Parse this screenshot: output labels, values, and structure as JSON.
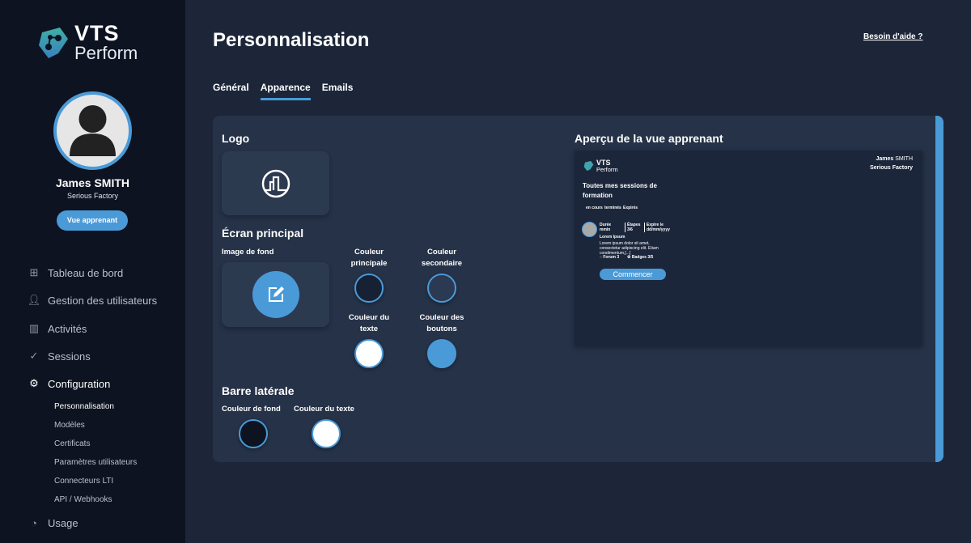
{
  "brand": {
    "line1": "VTS",
    "line2": "Perform"
  },
  "user": {
    "name": "James SMITH",
    "org": "Serious Factory",
    "learner_view_button": "Vue apprenant"
  },
  "nav": {
    "items": [
      {
        "label": "Tableau de bord",
        "icon": "dashboard-icon"
      },
      {
        "label": "Gestion des utilisateurs",
        "icon": "user-icon"
      },
      {
        "label": "Activités",
        "icon": "library-icon"
      },
      {
        "label": "Sessions",
        "icon": "route-icon"
      },
      {
        "label": "Configuration",
        "icon": "gear-icon"
      },
      {
        "label": "Usage",
        "icon": "gauge-icon"
      }
    ],
    "sub_items": [
      "Personnalisation",
      "Modèles",
      "Certificats",
      "Paramètres utilisateurs",
      "Connecteurs LTI",
      "API / Webhooks"
    ]
  },
  "header": {
    "title": "Personnalisation",
    "help": "Besoin d'aide ?"
  },
  "tabs": [
    "Général",
    "Apparence",
    "Emails"
  ],
  "form": {
    "logo_title": "Logo",
    "main_screen_title": "Écran principal",
    "bg_image_label": "Image de fond",
    "primary_color_label": "Couleur principale",
    "secondary_color_label": "Couleur secondaire",
    "text_color_label": "Couleur du texte",
    "button_color_label": "Couleur des boutons",
    "sidebar_title": "Barre latérale",
    "sidebar_bg_label": "Couleur de fond",
    "sidebar_text_label": "Couleur du texte",
    "colors": {
      "primary": "#172134",
      "secondary": "#2b3a52",
      "text": "#ffffff",
      "buttons": "#4a9ad8",
      "sidebar_bg": "#0d1320",
      "sidebar_text": "#ffffff"
    }
  },
  "preview": {
    "title": "Aperçu de la vue apprenant",
    "brand_line1": "VTS",
    "brand_line2": "Perform",
    "user_first": "James",
    "user_last": "SMITH",
    "org": "Serious Factory",
    "heading": "Toutes mes sessions de formation",
    "filters": [
      "en cours",
      "terminés",
      "Expirés"
    ],
    "session": {
      "duration": "Durée mmin",
      "steps": "Étapes 3/6",
      "expires": "Expire le dd/mm/yyyy",
      "name": "Lorem Ipsum",
      "desc": "Lorem ipsum dolor sit amet, consectetur adipiscing elit. Etiam condimentum,[...]",
      "forum": "Forum 3",
      "badges": "Badges 3/5"
    },
    "start_button": "Commencer"
  },
  "accent": "#4a9ad8"
}
